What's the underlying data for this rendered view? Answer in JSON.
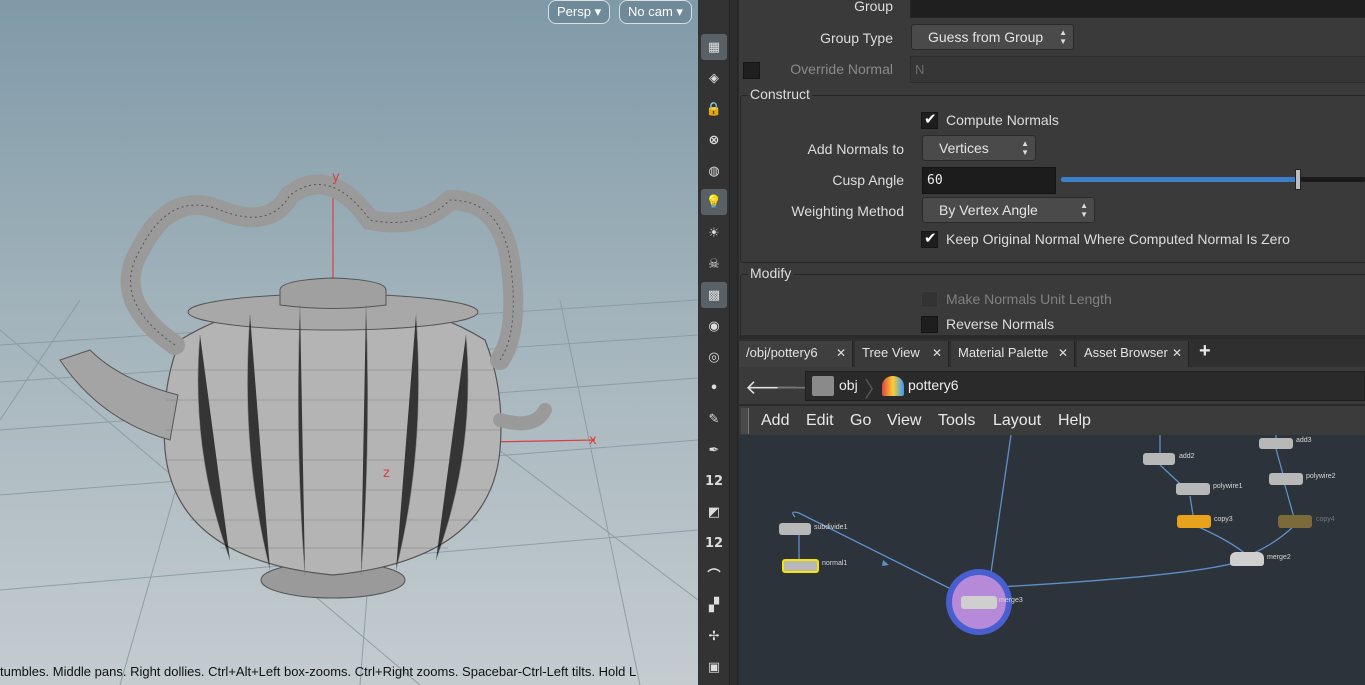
{
  "viewport": {
    "camera_view": "Persp",
    "camera_select": "No cam",
    "axis_x": "x",
    "axis_y": "y",
    "axis_z": "z",
    "status_hint": "tumbles. Middle pans. Right dollies. Ctrl+Alt+Left box-zooms. Ctrl+Right zooms. Spacebar-Ctrl-Left tilts. Hold L"
  },
  "toolshelf": {
    "items": [
      {
        "icon": "grid-icon",
        "active": true
      },
      {
        "icon": "display-options-icon",
        "active": false
      },
      {
        "icon": "lock-icon",
        "active": false
      },
      {
        "icon": "ghost-icon",
        "active": false
      },
      {
        "icon": "shading-icon",
        "active": false
      },
      {
        "icon": "headlight-icon",
        "active": true
      },
      {
        "icon": "light-icon",
        "active": false
      },
      {
        "icon": "skull-icon",
        "active": false
      },
      {
        "icon": "checker-icon",
        "active": true
      },
      {
        "icon": "eye-icon",
        "active": false
      },
      {
        "icon": "camera-eye-icon",
        "active": false
      },
      {
        "icon": "point-icon",
        "active": false
      },
      {
        "icon": "brush-icon",
        "active": false
      },
      {
        "icon": "pen-icon",
        "active": false
      },
      {
        "icon": "snap-12-icon",
        "active": false,
        "text": "12"
      },
      {
        "icon": "erase-icon",
        "active": false
      },
      {
        "icon": "snap-12b-icon",
        "active": false,
        "text": "12"
      },
      {
        "icon": "curve-icon",
        "active": false
      },
      {
        "icon": "grid-snap-icon",
        "active": false
      },
      {
        "icon": "vector-icon",
        "active": false
      },
      {
        "icon": "terminal-icon",
        "active": false
      }
    ]
  },
  "params": {
    "group_label": "Group",
    "group_type_label": "Group Type",
    "group_type_value": "Guess from Group",
    "override_normal_label": "Override Normal",
    "override_normal_value": "N",
    "construct_label": "Construct",
    "compute_normals_label": "Compute Normals",
    "compute_normals_checked": true,
    "add_normals_label": "Add Normals to",
    "add_normals_value": "Vertices",
    "cusp_angle_label": "Cusp Angle",
    "cusp_angle_value": "60",
    "cusp_angle_slider_fraction": 0.78,
    "weighting_label": "Weighting Method",
    "weighting_value": "By Vertex Angle",
    "keep_original_label": "Keep Original Normal Where Computed Normal Is Zero",
    "keep_original_checked": true,
    "modify_label": "Modify",
    "unit_length_label": "Make Normals Unit Length",
    "reverse_normals_label": "Reverse Normals"
  },
  "tabs": [
    {
      "label": "/obj/pottery6"
    },
    {
      "label": "Tree View"
    },
    {
      "label": "Material Palette"
    },
    {
      "label": "Asset Browser"
    }
  ],
  "tabs_add": "+",
  "path": {
    "back": "back-arrow-icon",
    "forward": "forward-arrow-icon",
    "crumb1": "obj",
    "crumb2": "pottery6"
  },
  "menu": {
    "add": "Add",
    "edit": "Edit",
    "go": "Go",
    "view": "View",
    "tools": "Tools",
    "layout": "Layout",
    "help": "Help"
  },
  "nodes": {
    "subdivide1": "subdivide1",
    "normal1": "normal1",
    "merge3": "merge3",
    "add2": "add2",
    "polywire1": "polywire1",
    "copy3": "copy3",
    "add3": "add3",
    "polywire2": "polywire2",
    "copy4": "copy4",
    "merge2": "merge2"
  },
  "colors": {
    "accent_blue": "#3d7fc7",
    "node_yellow": "#e8a21c",
    "node_highlight": "#6b5fc8",
    "selected_border": "#f5e400"
  }
}
